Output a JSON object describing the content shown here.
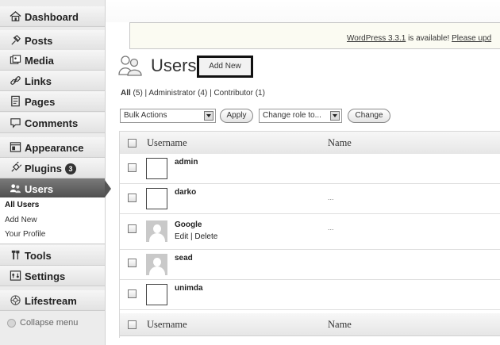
{
  "sidebar": {
    "items": [
      {
        "label": "Dashboard",
        "icon": "home-icon"
      },
      {
        "label": "Posts",
        "icon": "pin-icon"
      },
      {
        "label": "Media",
        "icon": "media-icon"
      },
      {
        "label": "Links",
        "icon": "link-icon"
      },
      {
        "label": "Pages",
        "icon": "pages-icon"
      },
      {
        "label": "Comments",
        "icon": "comment-icon"
      },
      {
        "label": "Appearance",
        "icon": "appearance-icon"
      },
      {
        "label": "Plugins",
        "icon": "plugin-icon",
        "badge": "3"
      },
      {
        "label": "Users",
        "icon": "users-icon",
        "active": true
      },
      {
        "label": "Tools",
        "icon": "tools-icon"
      },
      {
        "label": "Settings",
        "icon": "settings-icon"
      },
      {
        "label": "Lifestream",
        "icon": "lifestream-icon"
      }
    ],
    "submenu": [
      "All Users",
      "Add New",
      "Your Profile"
    ],
    "collapse_label": "Collapse menu"
  },
  "notice": {
    "version_link": "WordPress 3.3.1",
    "text": " is available! ",
    "update_link": "Please upd"
  },
  "header": {
    "title": "Users",
    "add_new": "Add New"
  },
  "filters": {
    "all": "All",
    "all_count": " (5)",
    "sep": " | ",
    "administrator": "Administrator (4)",
    "contributor": "Contributor (1)"
  },
  "actions": {
    "bulk_actions": "Bulk Actions",
    "apply": "Apply",
    "change_role": "Change role to...",
    "change": "Change"
  },
  "table": {
    "columns": [
      "Username",
      "Name"
    ],
    "rows": [
      {
        "username": "admin",
        "name": "",
        "avatar": "blank"
      },
      {
        "username": "darko",
        "name": "...",
        "avatar": "blank"
      },
      {
        "username": "Google",
        "name": "...",
        "avatar": "mystery-person",
        "row_actions": "Edit | Delete"
      },
      {
        "username": "sead",
        "name": "",
        "avatar": "mystery-person"
      },
      {
        "username": "unimda",
        "name": "",
        "avatar": "blank"
      }
    ]
  },
  "colors": {
    "active_menu": "#5a5a5a",
    "sidebar_bg": "#ececec",
    "notice_bg": "#fbfbf2"
  }
}
